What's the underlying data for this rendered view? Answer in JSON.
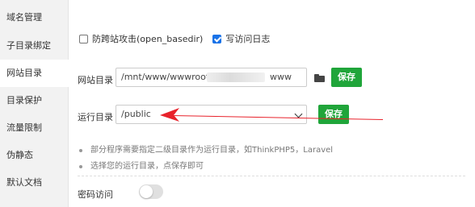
{
  "sidebar": {
    "items": [
      {
        "label": "域名管理"
      },
      {
        "label": "子目录绑定"
      },
      {
        "label": "网站目录"
      },
      {
        "label": "目录保护"
      },
      {
        "label": "流量限制"
      },
      {
        "label": "伪静态"
      },
      {
        "label": "默认文档"
      }
    ],
    "active_index": 2
  },
  "options": {
    "open_basedir": {
      "label": "防跨站攻击(open_basedir)",
      "checked": false
    },
    "access_log": {
      "label": "写访问日志",
      "checked": true
    }
  },
  "site_dir": {
    "label": "网站目录",
    "value_prefix": "/mnt/www/wwwroot/k",
    "value_suffix": "www",
    "save_label": "保存"
  },
  "run_dir": {
    "label": "运行目录",
    "value": "/public",
    "save_label": "保存"
  },
  "tips": [
    "部分程序需要指定二级目录作为运行目录，如ThinkPHP5，Laravel",
    "选择您的运行目录，点保存即可"
  ],
  "password_access": {
    "label": "密码访问",
    "enabled": false
  },
  "colors": {
    "accent_green": "#20a53a",
    "annotation_red": "#e8222b",
    "checkbox_blue": "#1a73e8"
  }
}
